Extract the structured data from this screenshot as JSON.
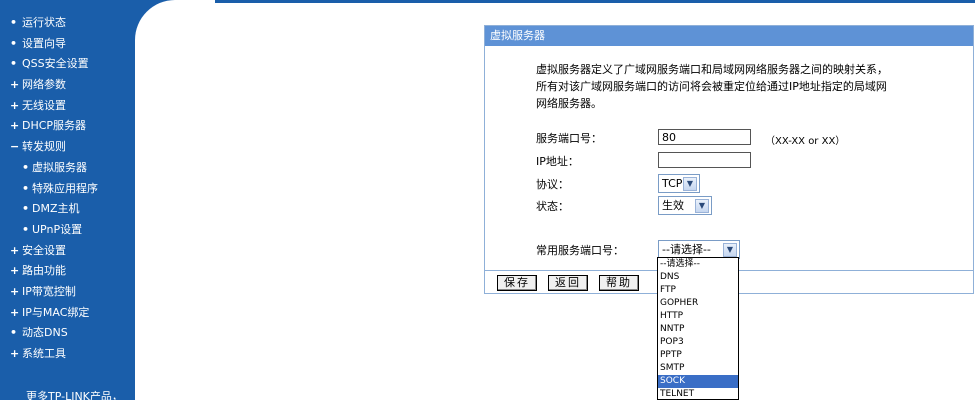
{
  "sidebar": {
    "items": [
      {
        "marker": "•",
        "label": "运行状态",
        "sub": false
      },
      {
        "marker": "•",
        "label": "设置向导",
        "sub": false
      },
      {
        "marker": "•",
        "label": "QSS安全设置",
        "sub": false
      },
      {
        "marker": "+",
        "label": "网络参数",
        "sub": false
      },
      {
        "marker": "+",
        "label": "无线设置",
        "sub": false
      },
      {
        "marker": "+",
        "label": "DHCP服务器",
        "sub": false
      },
      {
        "marker": "−",
        "label": "转发规则",
        "sub": false
      },
      {
        "marker": "•",
        "label": "虚拟服务器",
        "sub": true
      },
      {
        "marker": "•",
        "label": "特殊应用程序",
        "sub": true
      },
      {
        "marker": "•",
        "label": "DMZ主机",
        "sub": true
      },
      {
        "marker": "•",
        "label": "UPnP设置",
        "sub": true
      },
      {
        "marker": "+",
        "label": "安全设置",
        "sub": false
      },
      {
        "marker": "+",
        "label": "路由功能",
        "sub": false
      },
      {
        "marker": "+",
        "label": "IP带宽控制",
        "sub": false
      },
      {
        "marker": "+",
        "label": "IP与MAC绑定",
        "sub": false
      },
      {
        "marker": "•",
        "label": "动态DNS",
        "sub": false
      },
      {
        "marker": "+",
        "label": "系统工具",
        "sub": false
      }
    ],
    "more_text": "更多TP-LINK产品，"
  },
  "panel": {
    "title": "虚拟服务器",
    "description": [
      "虚拟服务器定义了广域网服务端口和局域网网络服务器之间的映射关系，",
      "所有对该广域网服务端口的访问将会被重定位给通过IP地址指定的局域网",
      "网络服务器。"
    ],
    "form": {
      "port_label": "服务端口号：",
      "port_value": "80",
      "port_hint": "（XX-XX or XX）",
      "ip_label": "IP地址：",
      "ip_value": "",
      "protocol_label": "协议：",
      "protocol_value": "TCP",
      "status_label": "状态：",
      "status_value": "生效",
      "common_port_label": "常用服务端口号：",
      "common_port_value": "--请选择--"
    },
    "buttons": {
      "save": "保存",
      "back": "返回",
      "help": "帮助"
    }
  },
  "dropdown": {
    "options": [
      "--请选择--",
      "DNS",
      "FTP",
      "GOPHER",
      "HTTP",
      "NNTP",
      "POP3",
      "PPTP",
      "SMTP",
      "SOCK",
      "TELNET"
    ],
    "highlighted": "SOCK"
  }
}
